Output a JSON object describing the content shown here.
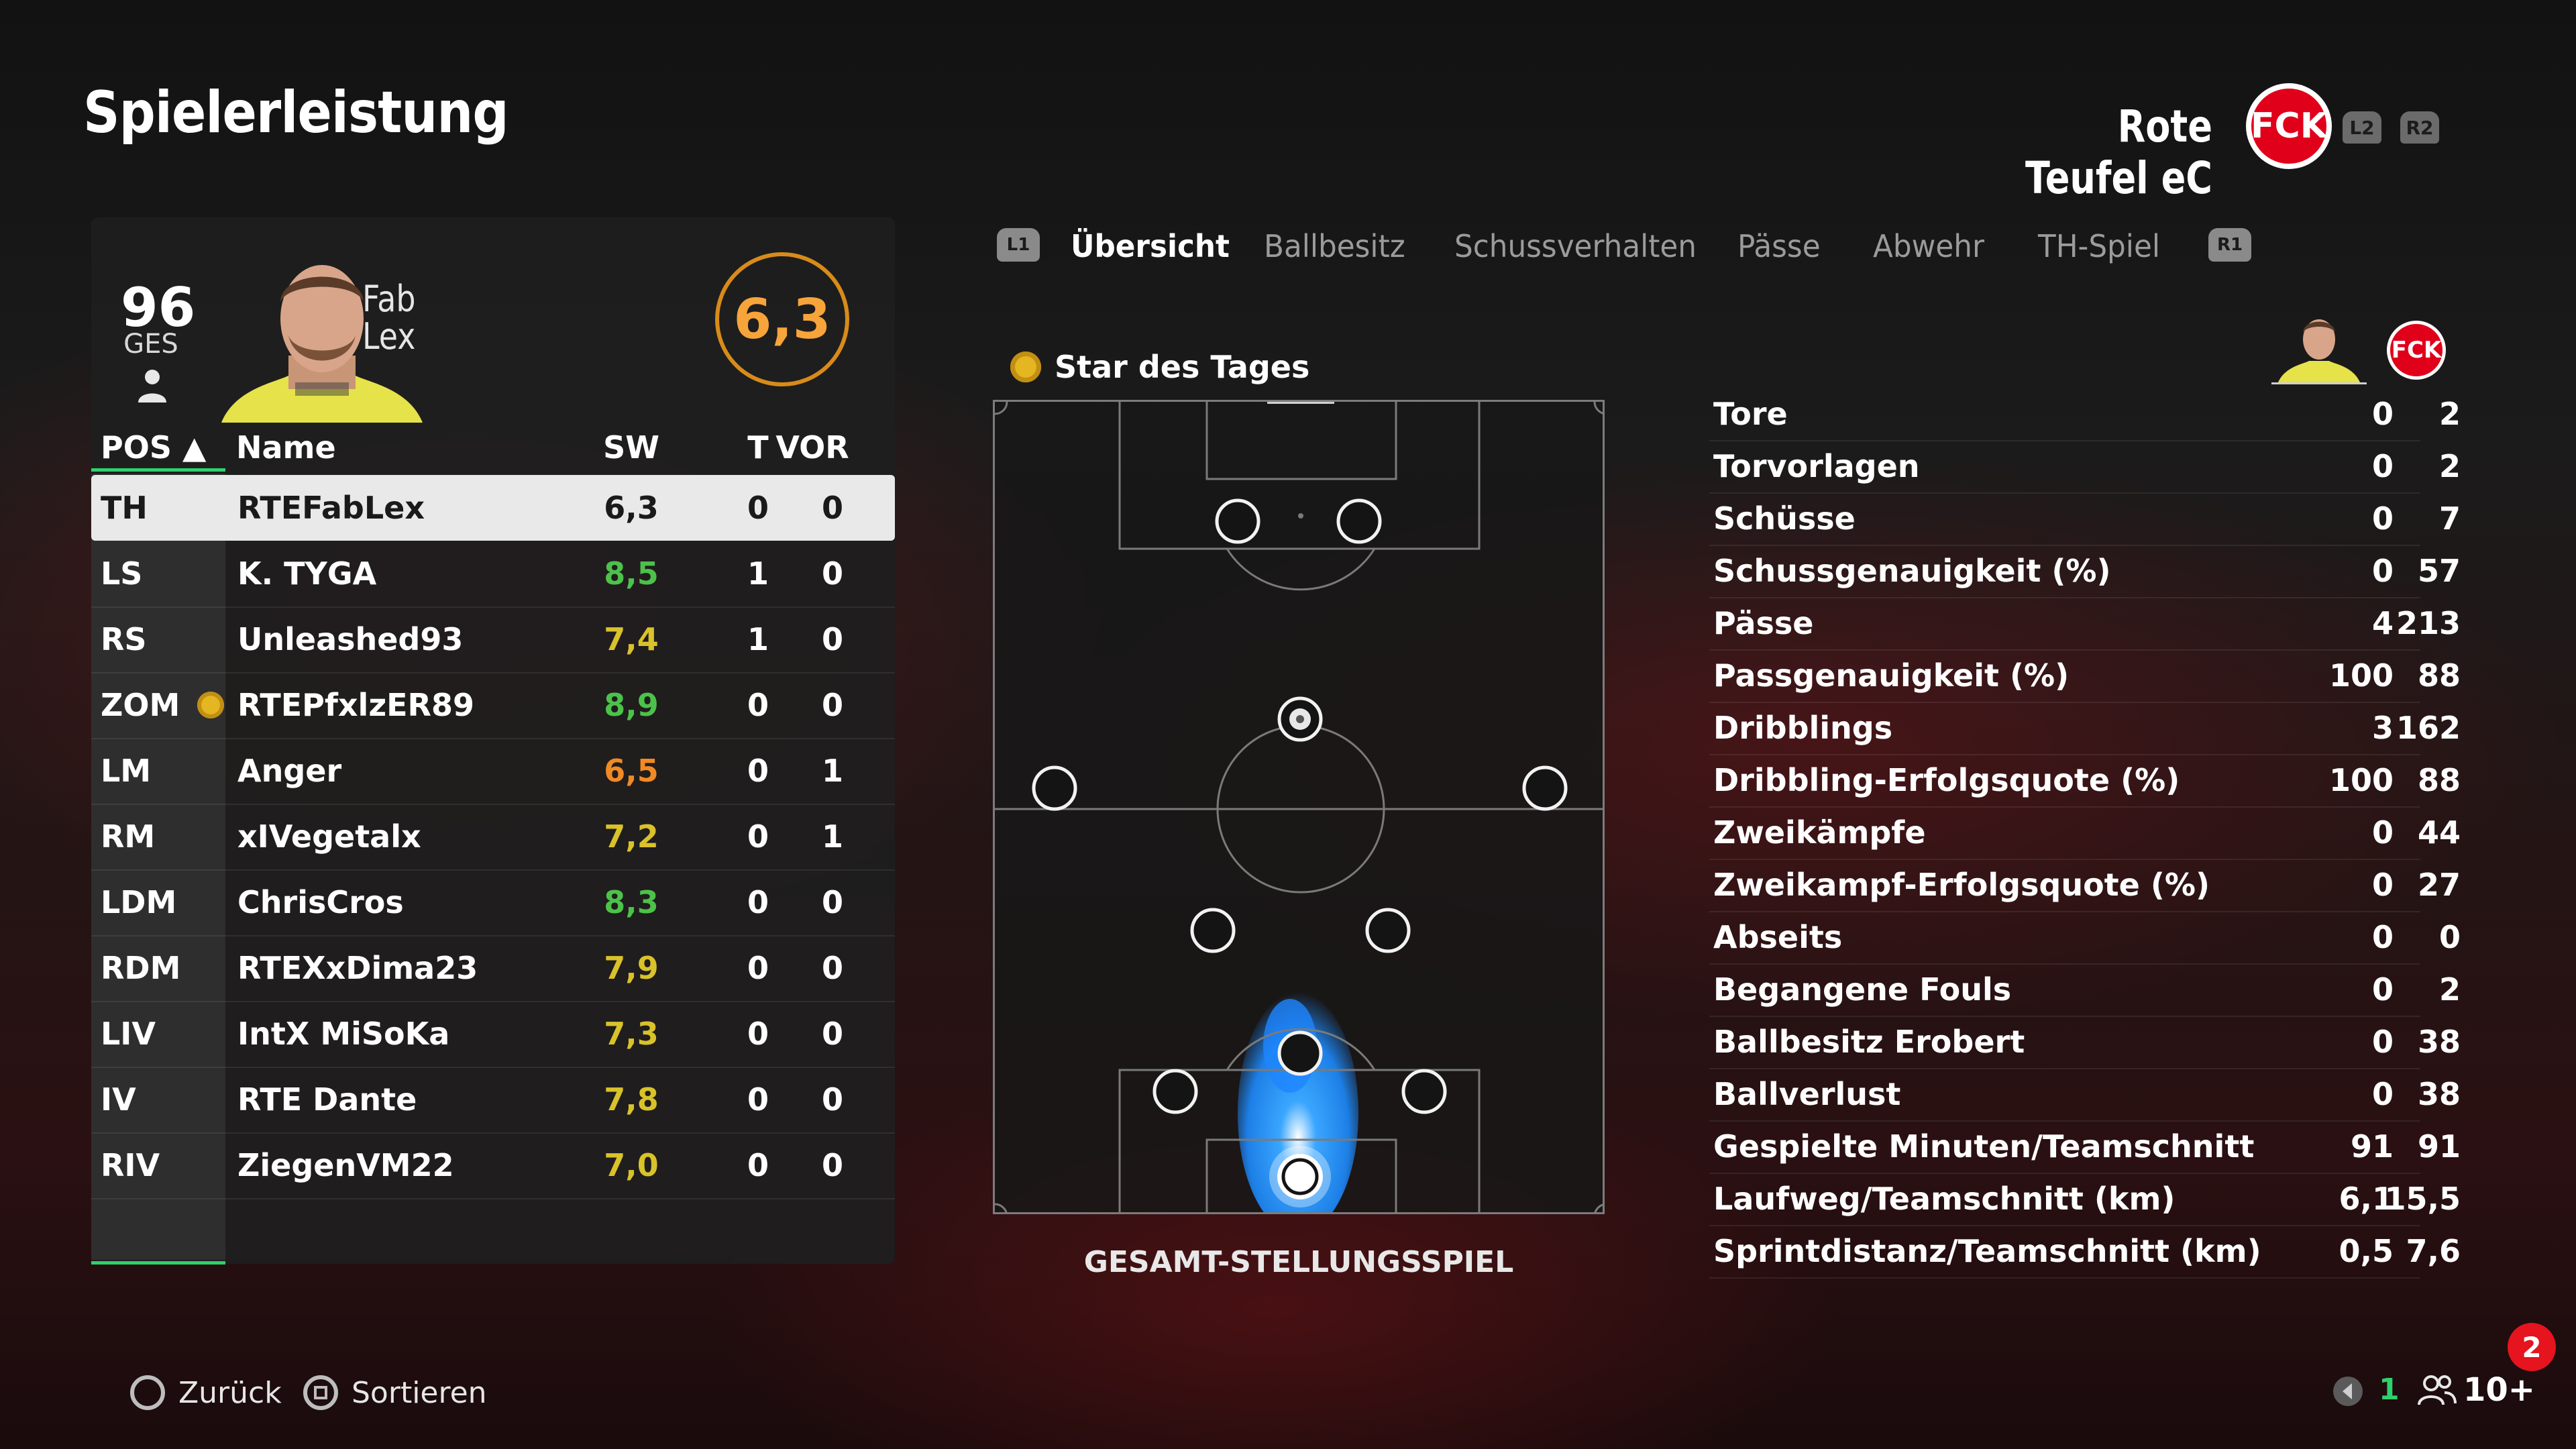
{
  "header": {
    "title": "Spielerleistung",
    "team_name": "Rote Teufel eC",
    "club_logo_text": "FCK",
    "trigger_left": "L2",
    "trigger_right": "R2"
  },
  "player_card": {
    "overall": "96",
    "overall_label": "GES",
    "first_name": "Fab",
    "last_name": "Lex",
    "rating": "6,3"
  },
  "table": {
    "columns": [
      "POS ▲",
      "Name",
      "SW",
      "T",
      "VOR"
    ],
    "rows": [
      {
        "pos": "TH",
        "name": "RTEFabLex",
        "sw": "6,3",
        "t": "0",
        "vor": "0",
        "sw_color": "#1a1a1a",
        "star": false
      },
      {
        "pos": "LS",
        "name": "K. TYGA",
        "sw": "8,5",
        "t": "1",
        "vor": "0",
        "sw_color": "#4cc24a",
        "star": false
      },
      {
        "pos": "RS",
        "name": "Unleashed93",
        "sw": "7,4",
        "t": "1",
        "vor": "0",
        "sw_color": "#d9c22a",
        "star": false
      },
      {
        "pos": "ZOM",
        "name": "RTEPfxlzER89",
        "sw": "8,9",
        "t": "0",
        "vor": "0",
        "sw_color": "#4cc24a",
        "star": true
      },
      {
        "pos": "LM",
        "name": "Anger",
        "sw": "6,5",
        "t": "0",
        "vor": "1",
        "sw_color": "#f08a24",
        "star": false
      },
      {
        "pos": "RM",
        "name": "xIVegetalx",
        "sw": "7,2",
        "t": "0",
        "vor": "1",
        "sw_color": "#d9c22a",
        "star": false
      },
      {
        "pos": "LDM",
        "name": "ChrisCros",
        "sw": "8,3",
        "t": "0",
        "vor": "0",
        "sw_color": "#4cc24a",
        "star": false
      },
      {
        "pos": "RDM",
        "name": "RTEXxDima23",
        "sw": "7,9",
        "t": "0",
        "vor": "0",
        "sw_color": "#d9c22a",
        "star": false
      },
      {
        "pos": "LIV",
        "name": "IntX MiSoKa",
        "sw": "7,3",
        "t": "0",
        "vor": "0",
        "sw_color": "#d9c22a",
        "star": false
      },
      {
        "pos": "IV",
        "name": "RTE Dante",
        "sw": "7,8",
        "t": "0",
        "vor": "0",
        "sw_color": "#d9c22a",
        "star": false
      },
      {
        "pos": "RIV",
        "name": "ZiegenVM22",
        "sw": "7,0",
        "t": "0",
        "vor": "0",
        "sw_color": "#d9c22a",
        "star": false
      }
    ]
  },
  "tabs": {
    "bumper_left": "L1",
    "bumper_right": "R1",
    "items": [
      "Übersicht",
      "Ballbesitz",
      "Schussverhalten",
      "Pässe",
      "Abwehr",
      "TH-Spiel"
    ],
    "active_index": 0
  },
  "pitch": {
    "star_label": "Star des Tages",
    "caption": "GESAMT-STELLUNGSSPIEL"
  },
  "stats": {
    "rows": [
      {
        "label": "Tore",
        "player": "0",
        "team": "2"
      },
      {
        "label": "Torvorlagen",
        "player": "0",
        "team": "2"
      },
      {
        "label": "Schüsse",
        "player": "0",
        "team": "7"
      },
      {
        "label": "Schussgenauigkeit (%)",
        "player": "0",
        "team": "57"
      },
      {
        "label": "Pässe",
        "player": "4",
        "team": "213"
      },
      {
        "label": "Passgenauigkeit (%)",
        "player": "100",
        "team": "88"
      },
      {
        "label": "Dribblings",
        "player": "3",
        "team": "162"
      },
      {
        "label": "Dribbling-Erfolgsquote (%)",
        "player": "100",
        "team": "88"
      },
      {
        "label": "Zweikämpfe",
        "player": "0",
        "team": "44"
      },
      {
        "label": "Zweikampf-Erfolgsquote (%)",
        "player": "0",
        "team": "27"
      },
      {
        "label": "Abseits",
        "player": "0",
        "team": "0"
      },
      {
        "label": "Begangene Fouls",
        "player": "0",
        "team": "2"
      },
      {
        "label": "Ballbesitz Erobert",
        "player": "0",
        "team": "38"
      },
      {
        "label": "Ballverlust",
        "player": "0",
        "team": "38"
      },
      {
        "label": "Gespielte Minuten/Teamschnitt",
        "player": "91",
        "team": "91"
      },
      {
        "label": "Laufweg/Teamschnitt (km)",
        "player": "6,1",
        "team": "15,5"
      },
      {
        "label": "Sprintdistanz/Teamschnitt (km)",
        "player": "0,5",
        "team": "7,6"
      }
    ]
  },
  "footer": {
    "back_label": "Zurück",
    "sort_label": "Sortieren",
    "notification_count": "2",
    "network_count": "1",
    "friends_count": "10+"
  },
  "colors": {
    "accent_green": "#2fd16b",
    "rating_orange": "#f7a43a",
    "club_red": "#e1001a"
  }
}
